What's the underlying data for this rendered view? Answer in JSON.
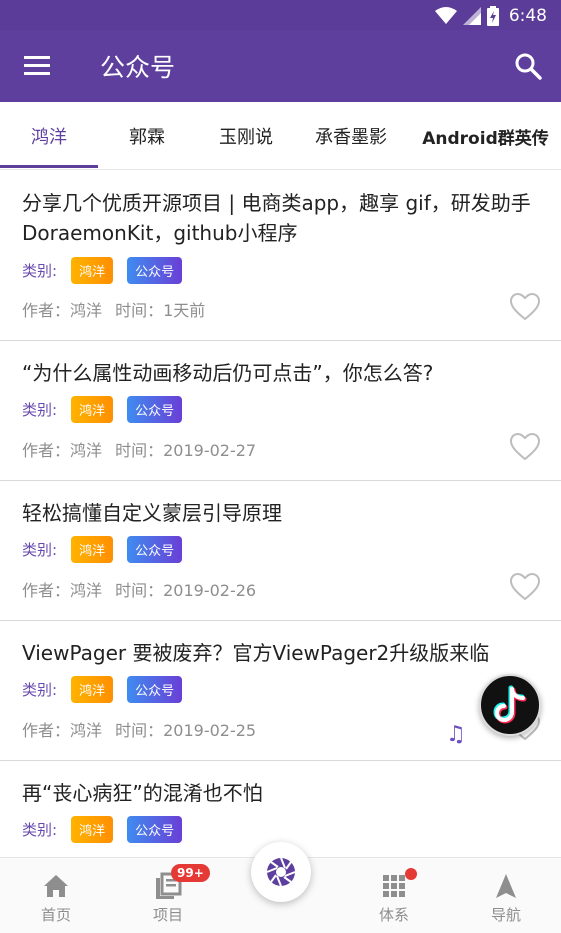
{
  "status_bar": {
    "time": "6:48",
    "icons": [
      "wifi-icon",
      "signal-icon",
      "battery-icon"
    ]
  },
  "app_bar": {
    "title": "公众号",
    "menu_icon": "menu-icon",
    "search_icon": "search-icon"
  },
  "tabs": [
    {
      "label": "鸿洋",
      "active": true
    },
    {
      "label": "郭霖",
      "active": false
    },
    {
      "label": "玉刚说",
      "active": false
    },
    {
      "label": "承香墨影",
      "active": false
    },
    {
      "label": "Android群英传",
      "active": false
    }
  ],
  "articles": [
    {
      "title": "分享几个优质开源项目 | 电商类app，趣享 gif，研发助手DoraemonKit，github小程序",
      "category_label": "类别:",
      "tag1": "鸿洋",
      "tag2": "公众号",
      "author": "作者：鸿洋",
      "time": "时间：1天前"
    },
    {
      "title": "“为什么属性动画移动后仍可点击”，你怎么答?",
      "category_label": "类别:",
      "tag1": "鸿洋",
      "tag2": "公众号",
      "author": "作者：鸿洋",
      "time": "时间：2019-02-27"
    },
    {
      "title": "轻松搞懂自定义蒙层引导原理",
      "category_label": "类别:",
      "tag1": "鸿洋",
      "tag2": "公众号",
      "author": "作者：鸿洋",
      "time": "时间：2019-02-26"
    },
    {
      "title": "ViewPager 要被废弃？官方ViewPager2升级版来临",
      "category_label": "类别:",
      "tag1": "鸿洋",
      "tag2": "公众号",
      "author": "作者：鸿洋",
      "time": "时间：2019-02-25"
    },
    {
      "title": "再“丧心病狂”的混淆也不怕",
      "category_label": "类别:",
      "tag1": "鸿洋",
      "tag2": "公众号",
      "author": "",
      "time": ""
    }
  ],
  "bottom_nav": [
    {
      "label": "首页",
      "icon": "home-icon"
    },
    {
      "label": "项目",
      "icon": "project-icon",
      "badge": "99+"
    },
    {
      "label": "体系",
      "icon": "grid-icon",
      "dot": true
    },
    {
      "label": "导航",
      "icon": "navigation-icon"
    }
  ],
  "fab": {
    "icon": "aperture-icon"
  },
  "colors": {
    "primary": "#5e3f9e",
    "status_bar": "#5b3c98",
    "accent_red": "#e53935",
    "tag_orange": "#ffa000",
    "tag_purple": "#5a6fe0"
  }
}
